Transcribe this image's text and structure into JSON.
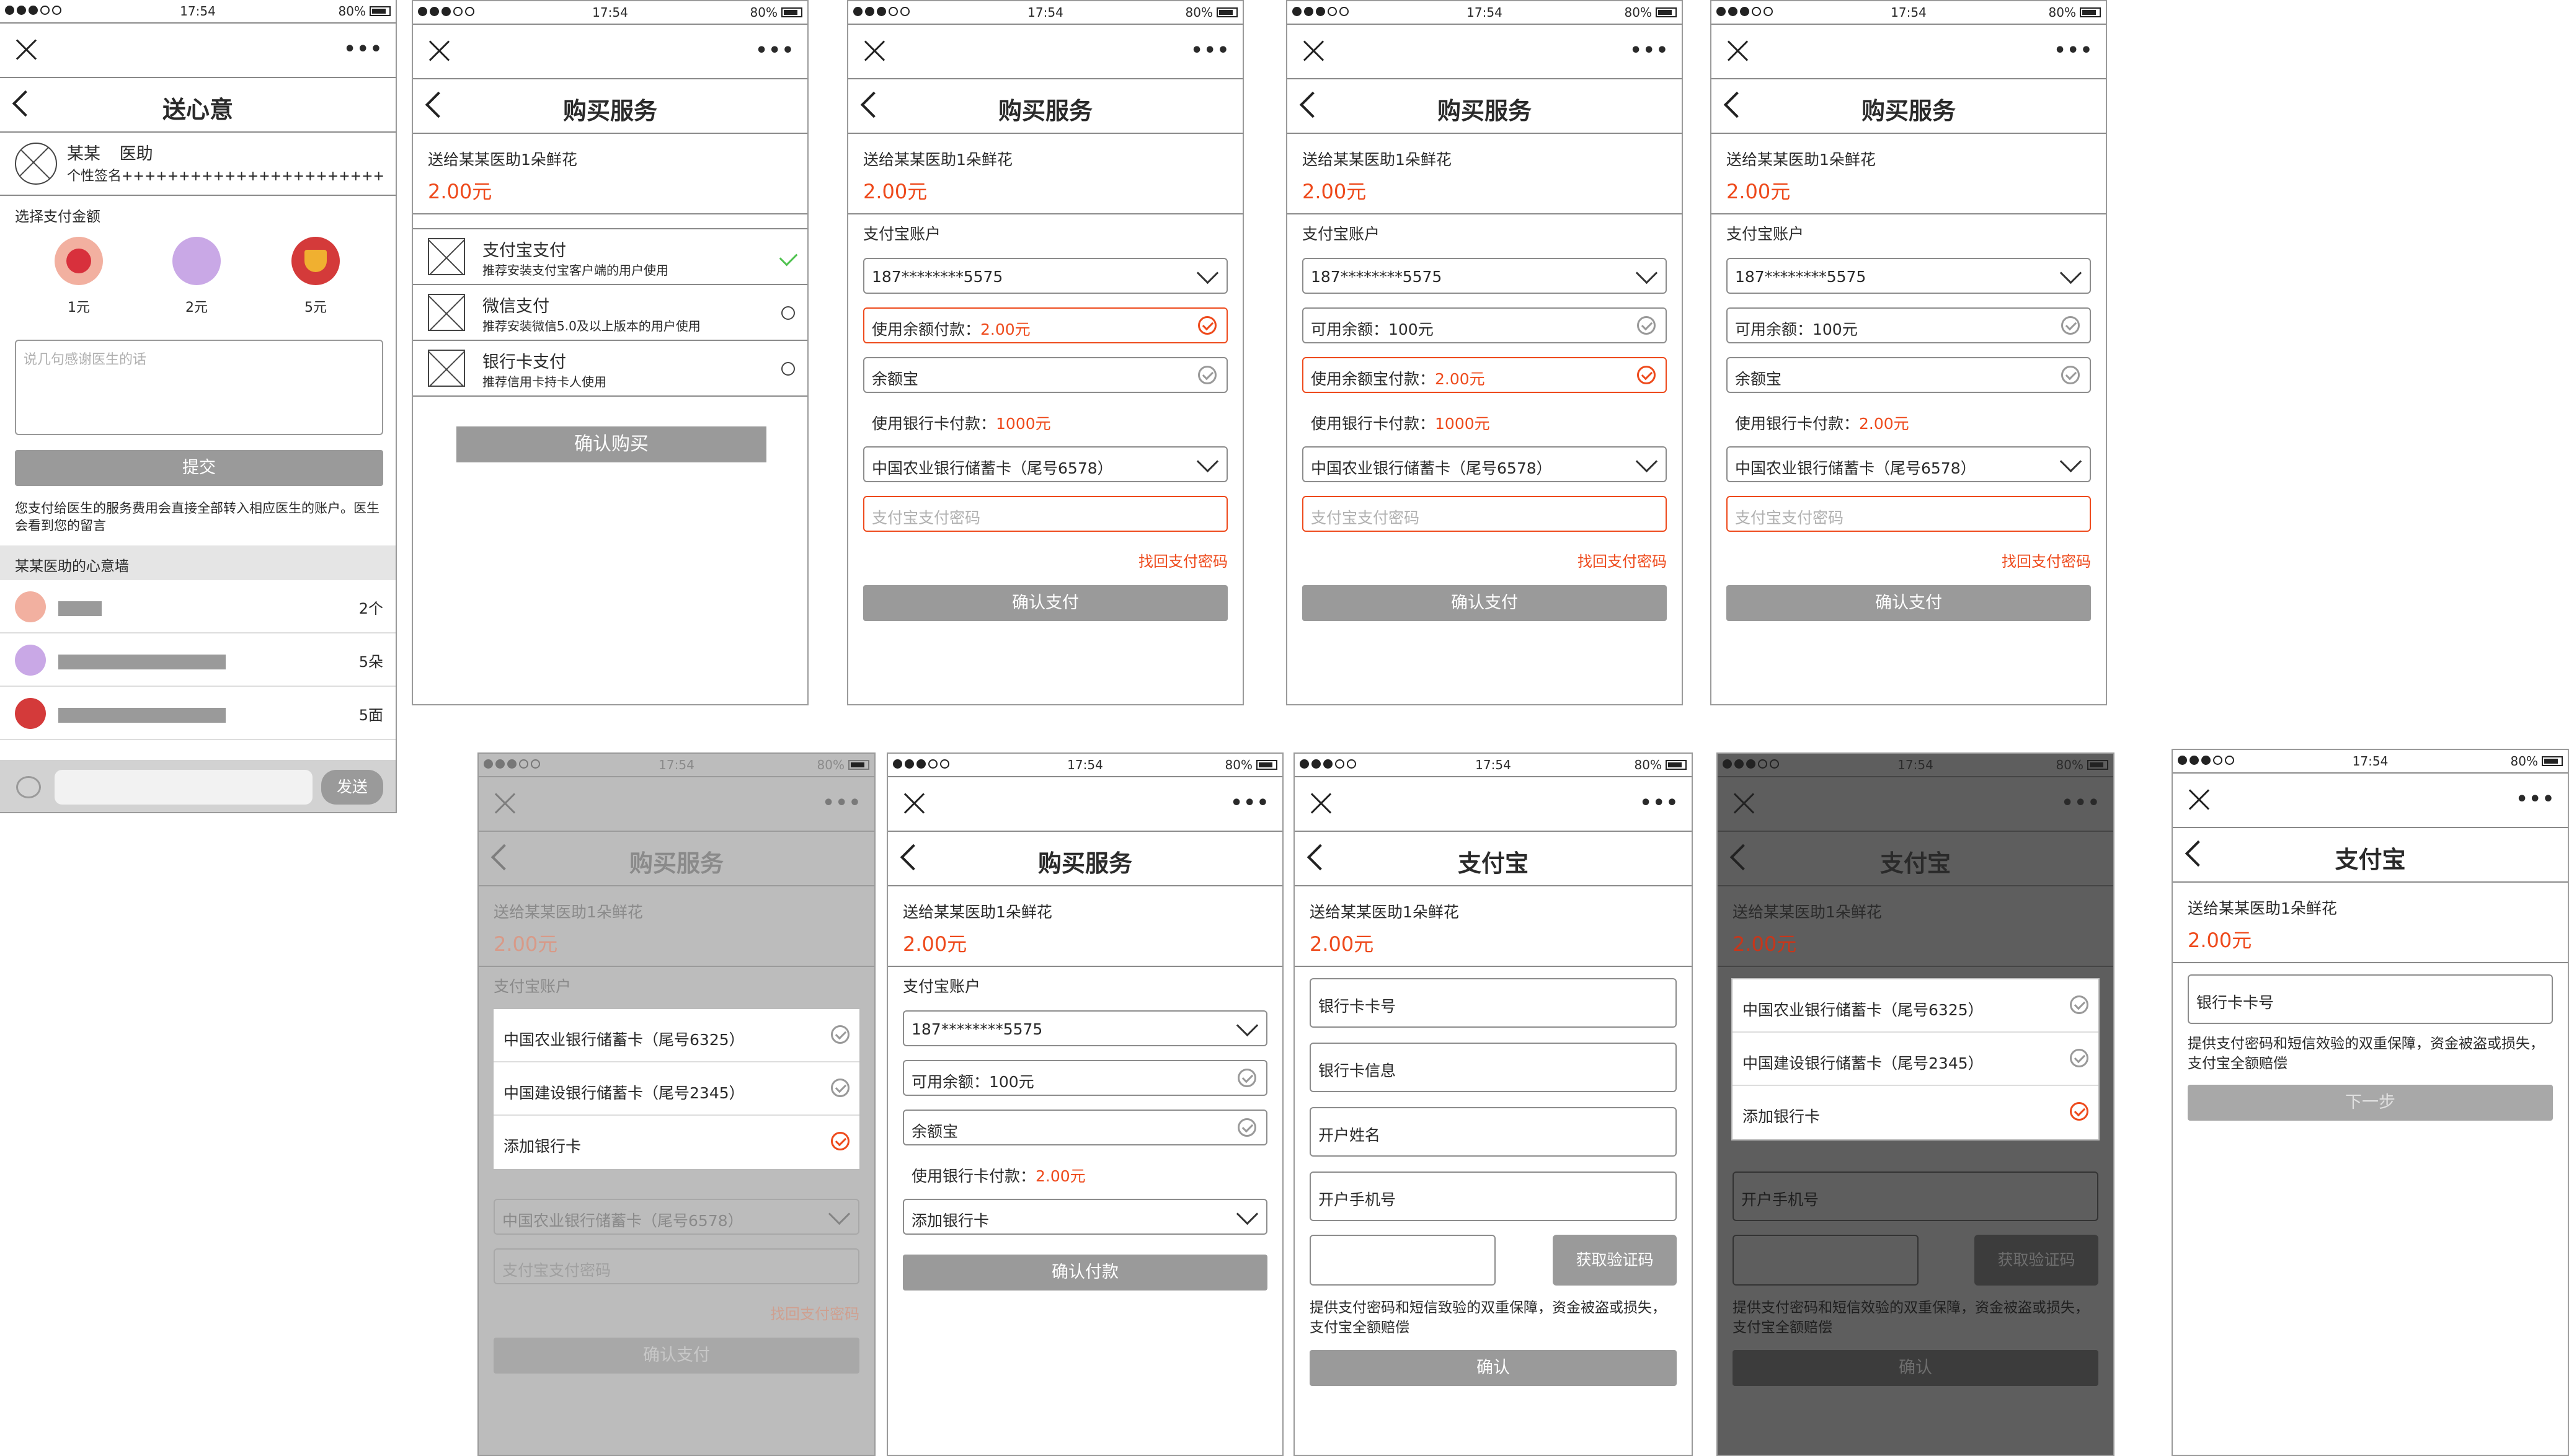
{
  "status": {
    "time": "17:54",
    "battery": "80%"
  },
  "colors": {
    "accent": "#ee4a1c",
    "button": "#9a9a9a",
    "border": "#8c8c8c"
  },
  "icons": {
    "close": "close-icon",
    "more": "more-icon",
    "back": "back-icon",
    "check": "check-icon",
    "dropdown": "chevron-down-icon"
  },
  "s1": {
    "title": "送心意",
    "doctor_name": "某某",
    "doctor_role": "医助",
    "signature": "个性签名+++++++++++++++++++++++",
    "choose_label": "选择支付金额",
    "gifts": [
      {
        "label": "1元"
      },
      {
        "label": "2元"
      },
      {
        "label": "5元"
      }
    ],
    "message_placeholder": "说几句感谢医生的话",
    "submit": "提交",
    "note": "您支付给医生的服务费用会直接全部转入相应医生的账户。医生会看到您的留言",
    "wall_title": "某某医助的心意墙",
    "wall": [
      {
        "count": "2个"
      },
      {
        "count": "5朵"
      },
      {
        "count": "5面"
      }
    ],
    "send": "发送"
  },
  "s2": {
    "title": "购买服务",
    "line": "送给某某医助1朵鲜花",
    "amount": "2.00元",
    "methods": [
      {
        "name": "支付宝支付",
        "desc": "推荐安装支付宝客户端的用户使用"
      },
      {
        "name": "微信支付",
        "desc": "推荐安装微信5.0及以上版本的用户使用"
      },
      {
        "name": "银行卡支付",
        "desc": "推荐信用卡持卡人使用"
      }
    ],
    "confirm": "确认购买"
  },
  "s3": {
    "title": "购买服务",
    "line": "送给某某医助1朵鲜花",
    "amount": "2.00元",
    "account_label": "支付宝账户",
    "account": "187********5575",
    "row1": "使用余额付款：",
    "row1_val": "2.00元",
    "row2": "余额宝",
    "bank_pay": "使用银行卡付款：",
    "bank_pay_val": "1000元",
    "card": "中国农业银行储蓄卡（尾号6578）",
    "pwd_placeholder": "支付宝支付密码",
    "forgot": "找回支付密码",
    "confirm": "确认支付"
  },
  "s4": {
    "title": "购买服务",
    "line": "送给某某医助1朵鲜花",
    "amount": "2.00元",
    "account_label": "支付宝账户",
    "account": "187********5575",
    "row1": "可用余额：100元",
    "row2": "使用余额宝付款：",
    "row2_val": "2.00元",
    "bank_pay": "使用银行卡付款：",
    "bank_pay_val": "1000元",
    "card": "中国农业银行储蓄卡（尾号6578）",
    "pwd_placeholder": "支付宝支付密码",
    "forgot": "找回支付密码",
    "confirm": "确认支付"
  },
  "s5": {
    "title": "购买服务",
    "line": "送给某某医助1朵鲜花",
    "amount": "2.00元",
    "account_label": "支付宝账户",
    "account": "187********5575",
    "row1": "可用余额：100元",
    "row2": "余额宝",
    "bank_pay": "使用银行卡付款：",
    "bank_pay_val": "2.00元",
    "card": "中国农业银行储蓄卡（尾号6578）",
    "pwd_placeholder": "支付宝支付密码",
    "forgot": "找回支付密码",
    "confirm": "确认支付"
  },
  "s6": {
    "title": "购买服务",
    "line": "送给某某医助1朵鲜花",
    "amount": "2.00元",
    "account_label": "支付宝账户",
    "options": [
      "中国农业银行储蓄卡（尾号6325）",
      "中国建设银行储蓄卡（尾号2345）",
      "添加银行卡"
    ],
    "card": "中国农业银行储蓄卡（尾号6578）",
    "pwd_placeholder": "支付宝支付密码",
    "forgot": "找回支付密码",
    "confirm": "确认支付"
  },
  "s7": {
    "title": "购买服务",
    "line": "送给某某医助1朵鲜花",
    "amount": "2.00元",
    "account_label": "支付宝账户",
    "account": "187********5575",
    "row1": "可用余额：100元",
    "row2": "余额宝",
    "bank_pay": "使用银行卡付款：",
    "bank_pay_val": "2.00元",
    "card": "添加银行卡",
    "confirm": "确认付款"
  },
  "s8": {
    "title": "支付宝",
    "line": "送给某某医助1朵鲜花",
    "amount": "2.00元",
    "fields": [
      "银行卡卡号",
      "银行卡信息",
      "开户姓名",
      "开户手机号"
    ],
    "get_code": "获取验证码",
    "notice": "提供支付密码和短信致验的双重保障，资金被盗或损失，支付宝全额赔偿",
    "confirm": "确认"
  },
  "s9": {
    "title": "支付宝",
    "line": "送给某某医助1朵鲜花",
    "amount": "2.00元",
    "options": [
      "中国农业银行储蓄卡（尾号6325）",
      "中国建设银行储蓄卡（尾号2345）",
      "添加银行卡"
    ],
    "phone": "开户手机号",
    "get_code": "获取验证码",
    "notice": "提供支付密码和短信效验的双重保障，资金被盗或损失，支付宝全额赔偿",
    "confirm": "确认"
  },
  "s10": {
    "title": "支付宝",
    "line": "送给某某医助1朵鲜花",
    "amount": "2.00元",
    "field": "银行卡卡号",
    "notice": "提供支付密码和短信效验的双重保障，资金被盗或损失，支付宝全额赔偿",
    "next": "下一步"
  }
}
